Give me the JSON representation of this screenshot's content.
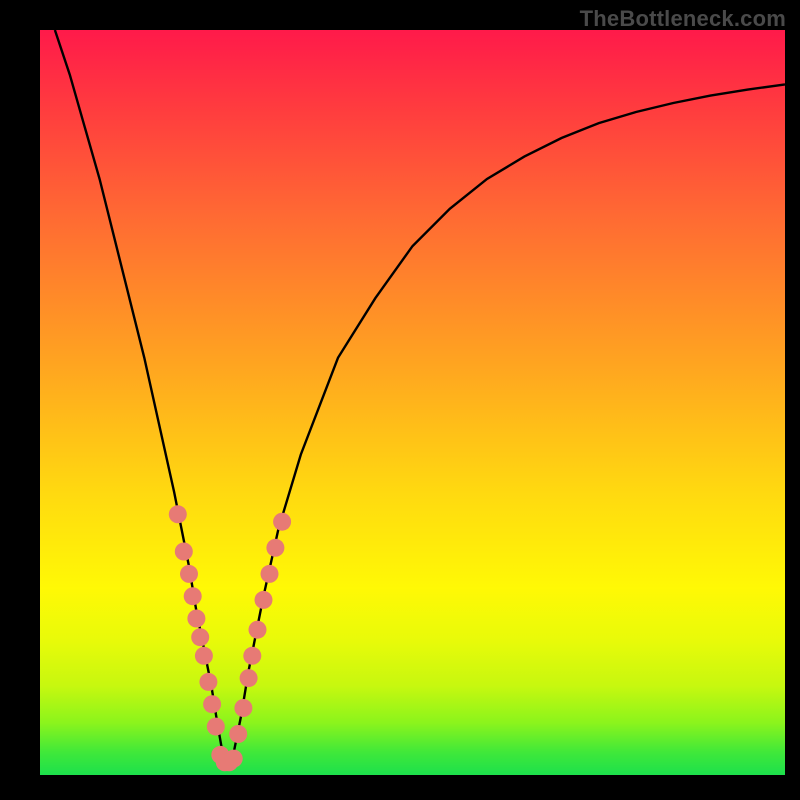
{
  "watermark": {
    "text": "TheBottleneck.com"
  },
  "colors": {
    "curve_stroke": "#000000",
    "marker_fill": "#e77a75",
    "marker_stroke": "#e77a75"
  },
  "chart_data": {
    "type": "line",
    "title": "",
    "xlabel": "",
    "ylabel": "",
    "xlim": [
      0,
      100
    ],
    "ylim": [
      0,
      100
    ],
    "grid": false,
    "series": [
      {
        "name": "bottleneck-curve",
        "x": [
          2,
          4,
          6,
          8,
          10,
          12,
          14,
          16,
          18,
          20,
          21,
          22,
          23,
          23.8,
          24.5,
          25,
          25.5,
          26,
          27,
          28,
          30,
          32,
          35,
          40,
          45,
          50,
          55,
          60,
          65,
          70,
          75,
          80,
          85,
          90,
          95,
          100
        ],
        "y": [
          100,
          94,
          87,
          80,
          72,
          64,
          56,
          47,
          38,
          28,
          22,
          17,
          12,
          7,
          3,
          1.5,
          1.5,
          3,
          8,
          14,
          24,
          33,
          43,
          56,
          64,
          71,
          76,
          80,
          83,
          85.5,
          87.5,
          89,
          90.2,
          91.2,
          92,
          92.7
        ]
      }
    ],
    "markers": {
      "name": "highlighted-points",
      "points": [
        {
          "x": 18.5,
          "y": 35
        },
        {
          "x": 19.3,
          "y": 30
        },
        {
          "x": 20.0,
          "y": 27
        },
        {
          "x": 20.5,
          "y": 24
        },
        {
          "x": 21.0,
          "y": 21
        },
        {
          "x": 21.5,
          "y": 18.5
        },
        {
          "x": 22.0,
          "y": 16
        },
        {
          "x": 22.6,
          "y": 12.5
        },
        {
          "x": 23.1,
          "y": 9.5
        },
        {
          "x": 23.6,
          "y": 6.5
        },
        {
          "x": 24.2,
          "y": 2.7
        },
        {
          "x": 24.8,
          "y": 1.7
        },
        {
          "x": 25.4,
          "y": 1.7
        },
        {
          "x": 26.0,
          "y": 2.2
        },
        {
          "x": 26.6,
          "y": 5.5
        },
        {
          "x": 27.3,
          "y": 9.0
        },
        {
          "x": 28.0,
          "y": 13.0
        },
        {
          "x": 28.5,
          "y": 16.0
        },
        {
          "x": 29.2,
          "y": 19.5
        },
        {
          "x": 30.0,
          "y": 23.5
        },
        {
          "x": 30.8,
          "y": 27.0
        },
        {
          "x": 31.6,
          "y": 30.5
        },
        {
          "x": 32.5,
          "y": 34.0
        }
      ]
    }
  }
}
